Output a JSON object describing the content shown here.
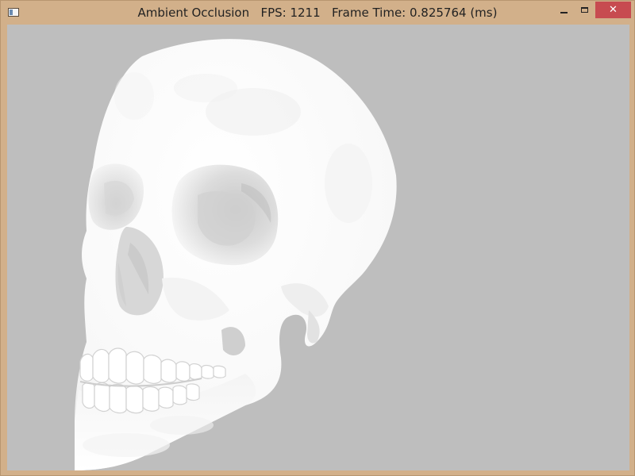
{
  "window": {
    "title_app": "Ambient Occlusion",
    "title_fps": "FPS: 1211",
    "title_frame_time": "Frame Time: 0.825764 (ms)",
    "close_glyph": "✕"
  },
  "icons": {
    "app": "app-window-icon",
    "minimize": "minimize-icon",
    "maximize": "maximize-icon",
    "close": "close-icon"
  },
  "colors": {
    "frame": "#d2b08a",
    "viewport_background": "#bebebe",
    "close_button": "#c74b50",
    "model": "#ffffff"
  },
  "scene": {
    "object": "skull-model",
    "shading": "ambient-occlusion"
  }
}
